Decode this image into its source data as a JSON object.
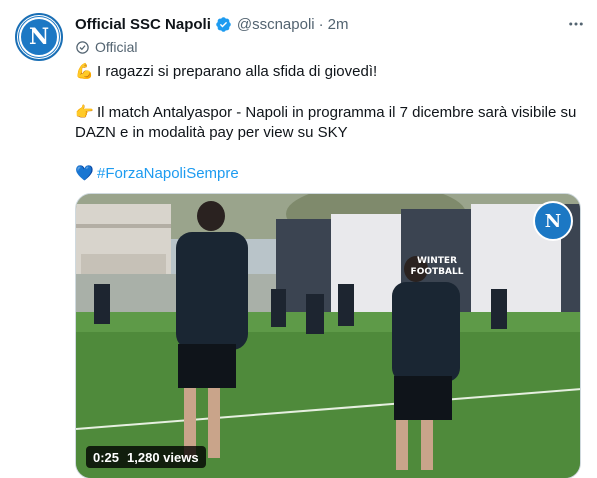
{
  "author": {
    "display_name": "Official SSC Napoli",
    "handle": "@sscnapoli",
    "separator": "·",
    "time": "2m",
    "label": "Official",
    "avatar_letter": "N"
  },
  "tweet": {
    "line1_emoji": "💪",
    "line1_text": "I ragazzi si preparano alla sfida di giovedì!",
    "line2_emoji": "👉",
    "line2_text": "Il match Antalyaspor - Napoli in programma il 7 dicembre sarà visibile su DAZN e in modalità pay per view su SKY",
    "line3_emoji": "💙",
    "hashtag": "#ForzaNapoliSempre"
  },
  "media": {
    "duration": "0:25",
    "views": "1,280 views",
    "logo_letter": "N",
    "banner_text_1": "WINTER",
    "banner_text_2": "FOOTBALL"
  },
  "colors": {
    "accent": "#1d9bf0",
    "napoli_blue": "#1c78c4",
    "text": "#0f1419",
    "muted": "#536471"
  }
}
